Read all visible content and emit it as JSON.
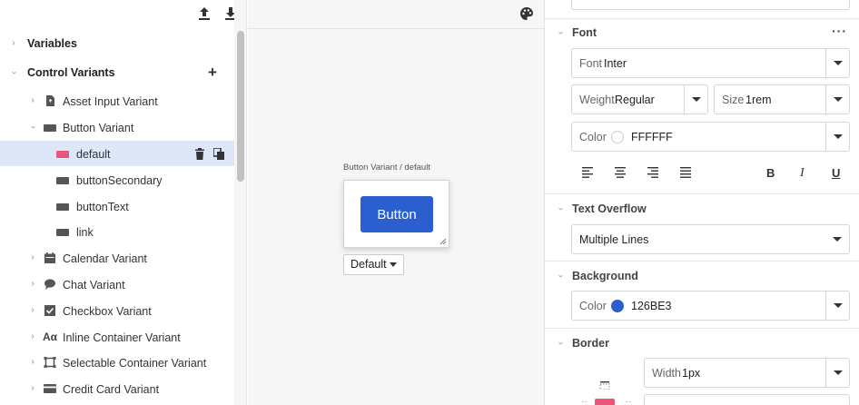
{
  "left_panel": {
    "toolbar": {
      "upload_icon": "upload-icon",
      "download_icon": "download-icon"
    },
    "tree": {
      "variables": "Variables",
      "control_variants": "Control Variants",
      "items": [
        {
          "label": "Asset Input Variant",
          "icon": "file-plus-icon"
        },
        {
          "label": "Button Variant",
          "icon": "button-shape-icon"
        },
        {
          "label": "default",
          "icon": "button-shape-icon",
          "color": "#e8567a",
          "selected": true
        },
        {
          "label": "buttonSecondary",
          "icon": "button-shape-icon"
        },
        {
          "label": "buttonText",
          "icon": "button-shape-icon"
        },
        {
          "label": "link",
          "icon": "button-shape-icon"
        },
        {
          "label": "Calendar Variant",
          "icon": "calendar-icon"
        },
        {
          "label": "Chat Variant",
          "icon": "chat-icon"
        },
        {
          "label": "Checkbox Variant",
          "icon": "checkbox-icon"
        },
        {
          "label": "Inline Container Variant",
          "icon": "text-aa-icon"
        },
        {
          "label": "Selectable Container Variant",
          "icon": "selectable-frame-icon"
        },
        {
          "label": "Credit Card Variant",
          "icon": "credit-card-icon"
        }
      ]
    }
  },
  "canvas": {
    "caption": "Button Variant / default",
    "button_label": "Button",
    "variant_select": "Default",
    "button_color": "#2b5fd0"
  },
  "right_panel": {
    "font": {
      "title": "Font",
      "font_label": "Font",
      "font_value": "Inter",
      "weight_label": "Weight",
      "weight_value": "Regular",
      "size_label": "Size",
      "size_value": "1rem",
      "color_label": "Color",
      "color_value": "FFFFFF",
      "color_hex": "#ffffff",
      "bold": "B",
      "italic": "I",
      "underline": "U"
    },
    "text_overflow": {
      "title": "Text Overflow",
      "value": "Multiple Lines"
    },
    "background": {
      "title": "Background",
      "color_label": "Color",
      "color_value": "126BE3",
      "color_hex": "#2b5fd0"
    },
    "border": {
      "title": "Border",
      "width_label": "Width",
      "width_value": "1px"
    }
  }
}
